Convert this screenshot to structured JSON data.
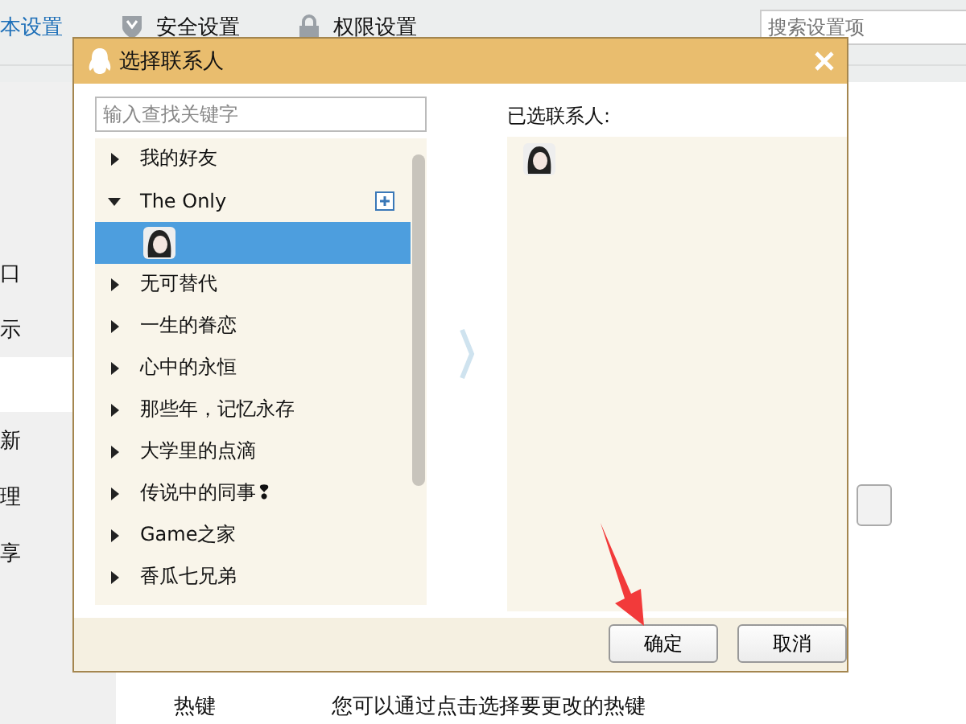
{
  "settings_tabs": [
    {
      "label": "本设置",
      "selected": true
    },
    {
      "label": "安全设置",
      "selected": false
    },
    {
      "label": "权限设置",
      "selected": false
    }
  ],
  "settings_search": {
    "placeholder": "搜索设置项"
  },
  "sidebar": {
    "items": [
      {
        "label": "口",
        "selected": false
      },
      {
        "label": "示",
        "selected": false
      },
      {
        "selected": true
      },
      {
        "label": "新",
        "selected": false
      },
      {
        "label": "理",
        "selected": false
      },
      {
        "label": "享",
        "selected": false
      }
    ]
  },
  "hotkey_row": {
    "label": "热键",
    "description": "您可以通过点击选择要更改的热键"
  },
  "dialog": {
    "title": "选择联系人",
    "search": {
      "placeholder": "输入查找关键字"
    },
    "groups": [
      {
        "name": "我的好友",
        "expanded": false
      },
      {
        "name": "The Only",
        "expanded": true,
        "children": [
          {
            "selected": true
          }
        ]
      },
      {
        "name": "无可替代",
        "expanded": false
      },
      {
        "name": "一生的眷恋",
        "expanded": false
      },
      {
        "name": "心中的永恒",
        "expanded": false
      },
      {
        "name": "那些年，记忆永存",
        "expanded": false
      },
      {
        "name": "大学里的点滴",
        "expanded": false
      },
      {
        "name": "传说中的同事❢",
        "expanded": false
      },
      {
        "name": "Game之家",
        "expanded": false
      },
      {
        "name": "香瓜七兄弟",
        "expanded": false
      }
    ],
    "selected_label": "已选联系人:",
    "selected_contacts": [
      {
        "avatar": true
      }
    ],
    "buttons": [
      "确定",
      "取消"
    ]
  }
}
